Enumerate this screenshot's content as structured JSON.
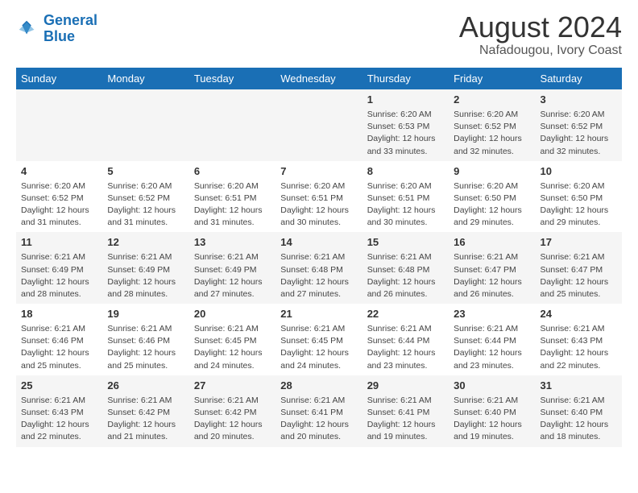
{
  "logo": {
    "line1": "General",
    "line2": "Blue"
  },
  "title": "August 2024",
  "subtitle": "Nafadougou, Ivory Coast",
  "days_header": [
    "Sunday",
    "Monday",
    "Tuesday",
    "Wednesday",
    "Thursday",
    "Friday",
    "Saturday"
  ],
  "weeks": [
    [
      {
        "num": "",
        "info": ""
      },
      {
        "num": "",
        "info": ""
      },
      {
        "num": "",
        "info": ""
      },
      {
        "num": "",
        "info": ""
      },
      {
        "num": "1",
        "info": "Sunrise: 6:20 AM\nSunset: 6:53 PM\nDaylight: 12 hours\nand 33 minutes."
      },
      {
        "num": "2",
        "info": "Sunrise: 6:20 AM\nSunset: 6:52 PM\nDaylight: 12 hours\nand 32 minutes."
      },
      {
        "num": "3",
        "info": "Sunrise: 6:20 AM\nSunset: 6:52 PM\nDaylight: 12 hours\nand 32 minutes."
      }
    ],
    [
      {
        "num": "4",
        "info": "Sunrise: 6:20 AM\nSunset: 6:52 PM\nDaylight: 12 hours\nand 31 minutes."
      },
      {
        "num": "5",
        "info": "Sunrise: 6:20 AM\nSunset: 6:52 PM\nDaylight: 12 hours\nand 31 minutes."
      },
      {
        "num": "6",
        "info": "Sunrise: 6:20 AM\nSunset: 6:51 PM\nDaylight: 12 hours\nand 31 minutes."
      },
      {
        "num": "7",
        "info": "Sunrise: 6:20 AM\nSunset: 6:51 PM\nDaylight: 12 hours\nand 30 minutes."
      },
      {
        "num": "8",
        "info": "Sunrise: 6:20 AM\nSunset: 6:51 PM\nDaylight: 12 hours\nand 30 minutes."
      },
      {
        "num": "9",
        "info": "Sunrise: 6:20 AM\nSunset: 6:50 PM\nDaylight: 12 hours\nand 29 minutes."
      },
      {
        "num": "10",
        "info": "Sunrise: 6:20 AM\nSunset: 6:50 PM\nDaylight: 12 hours\nand 29 minutes."
      }
    ],
    [
      {
        "num": "11",
        "info": "Sunrise: 6:21 AM\nSunset: 6:49 PM\nDaylight: 12 hours\nand 28 minutes."
      },
      {
        "num": "12",
        "info": "Sunrise: 6:21 AM\nSunset: 6:49 PM\nDaylight: 12 hours\nand 28 minutes."
      },
      {
        "num": "13",
        "info": "Sunrise: 6:21 AM\nSunset: 6:49 PM\nDaylight: 12 hours\nand 27 minutes."
      },
      {
        "num": "14",
        "info": "Sunrise: 6:21 AM\nSunset: 6:48 PM\nDaylight: 12 hours\nand 27 minutes."
      },
      {
        "num": "15",
        "info": "Sunrise: 6:21 AM\nSunset: 6:48 PM\nDaylight: 12 hours\nand 26 minutes."
      },
      {
        "num": "16",
        "info": "Sunrise: 6:21 AM\nSunset: 6:47 PM\nDaylight: 12 hours\nand 26 minutes."
      },
      {
        "num": "17",
        "info": "Sunrise: 6:21 AM\nSunset: 6:47 PM\nDaylight: 12 hours\nand 25 minutes."
      }
    ],
    [
      {
        "num": "18",
        "info": "Sunrise: 6:21 AM\nSunset: 6:46 PM\nDaylight: 12 hours\nand 25 minutes."
      },
      {
        "num": "19",
        "info": "Sunrise: 6:21 AM\nSunset: 6:46 PM\nDaylight: 12 hours\nand 25 minutes."
      },
      {
        "num": "20",
        "info": "Sunrise: 6:21 AM\nSunset: 6:45 PM\nDaylight: 12 hours\nand 24 minutes."
      },
      {
        "num": "21",
        "info": "Sunrise: 6:21 AM\nSunset: 6:45 PM\nDaylight: 12 hours\nand 24 minutes."
      },
      {
        "num": "22",
        "info": "Sunrise: 6:21 AM\nSunset: 6:44 PM\nDaylight: 12 hours\nand 23 minutes."
      },
      {
        "num": "23",
        "info": "Sunrise: 6:21 AM\nSunset: 6:44 PM\nDaylight: 12 hours\nand 23 minutes."
      },
      {
        "num": "24",
        "info": "Sunrise: 6:21 AM\nSunset: 6:43 PM\nDaylight: 12 hours\nand 22 minutes."
      }
    ],
    [
      {
        "num": "25",
        "info": "Sunrise: 6:21 AM\nSunset: 6:43 PM\nDaylight: 12 hours\nand 22 minutes."
      },
      {
        "num": "26",
        "info": "Sunrise: 6:21 AM\nSunset: 6:42 PM\nDaylight: 12 hours\nand 21 minutes."
      },
      {
        "num": "27",
        "info": "Sunrise: 6:21 AM\nSunset: 6:42 PM\nDaylight: 12 hours\nand 20 minutes."
      },
      {
        "num": "28",
        "info": "Sunrise: 6:21 AM\nSunset: 6:41 PM\nDaylight: 12 hours\nand 20 minutes."
      },
      {
        "num": "29",
        "info": "Sunrise: 6:21 AM\nSunset: 6:41 PM\nDaylight: 12 hours\nand 19 minutes."
      },
      {
        "num": "30",
        "info": "Sunrise: 6:21 AM\nSunset: 6:40 PM\nDaylight: 12 hours\nand 19 minutes."
      },
      {
        "num": "31",
        "info": "Sunrise: 6:21 AM\nSunset: 6:40 PM\nDaylight: 12 hours\nand 18 minutes."
      }
    ]
  ]
}
